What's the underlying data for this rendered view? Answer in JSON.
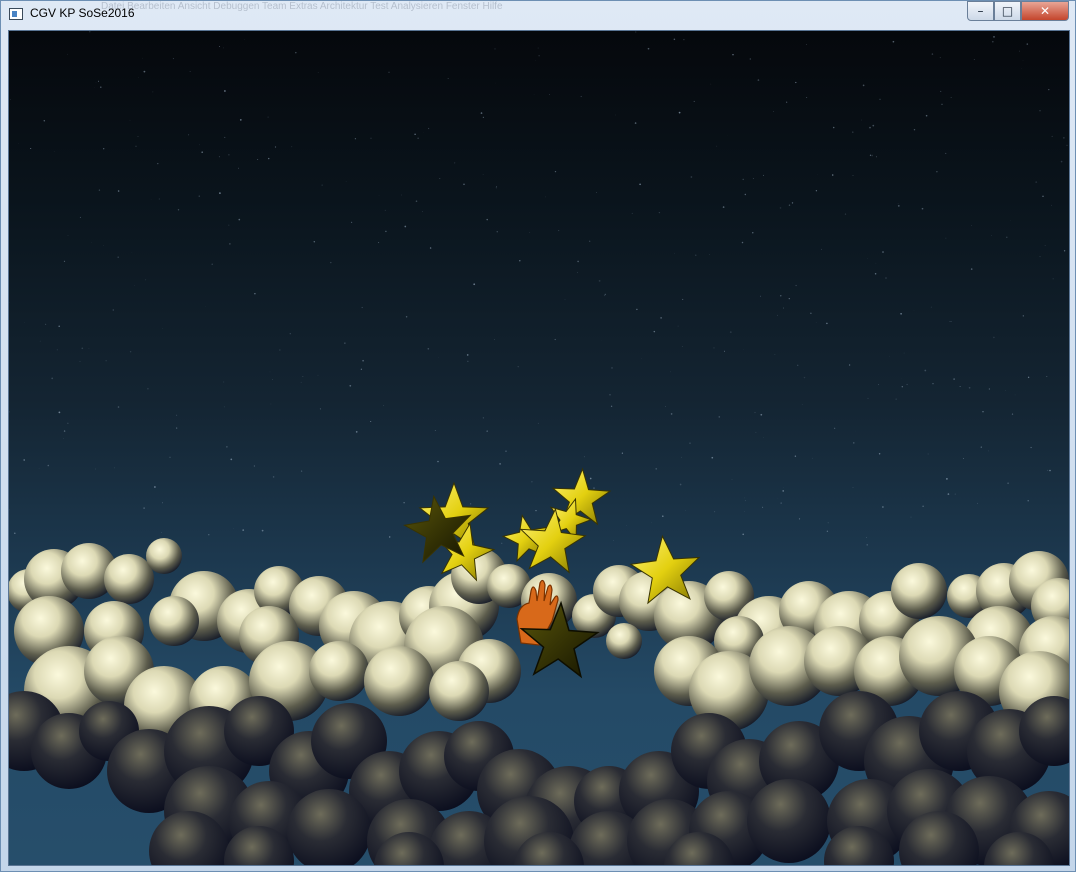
{
  "window": {
    "title": "CGV KP SoSe2016",
    "app_icon": "window-app-icon",
    "background_menu_text": "Datei   Bearbeiten   Ansicht   Debuggen   Team   Extras   Architektur   Test   Analysieren   Fenster   Hilfe",
    "controls": {
      "minimize": "–",
      "maximize": "□",
      "close": "✕"
    }
  },
  "scene": {
    "sky_colors": [
      "#05080c",
      "#142533",
      "#264e6b"
    ],
    "cloud_color": "#f6f4d2",
    "cloud_shadow": "#0a1022",
    "star_color": "#f2e21a",
    "hand_color": "#d8691a",
    "icons": [
      "star-icon",
      "cloud-sphere-icon",
      "hand-icon"
    ]
  }
}
